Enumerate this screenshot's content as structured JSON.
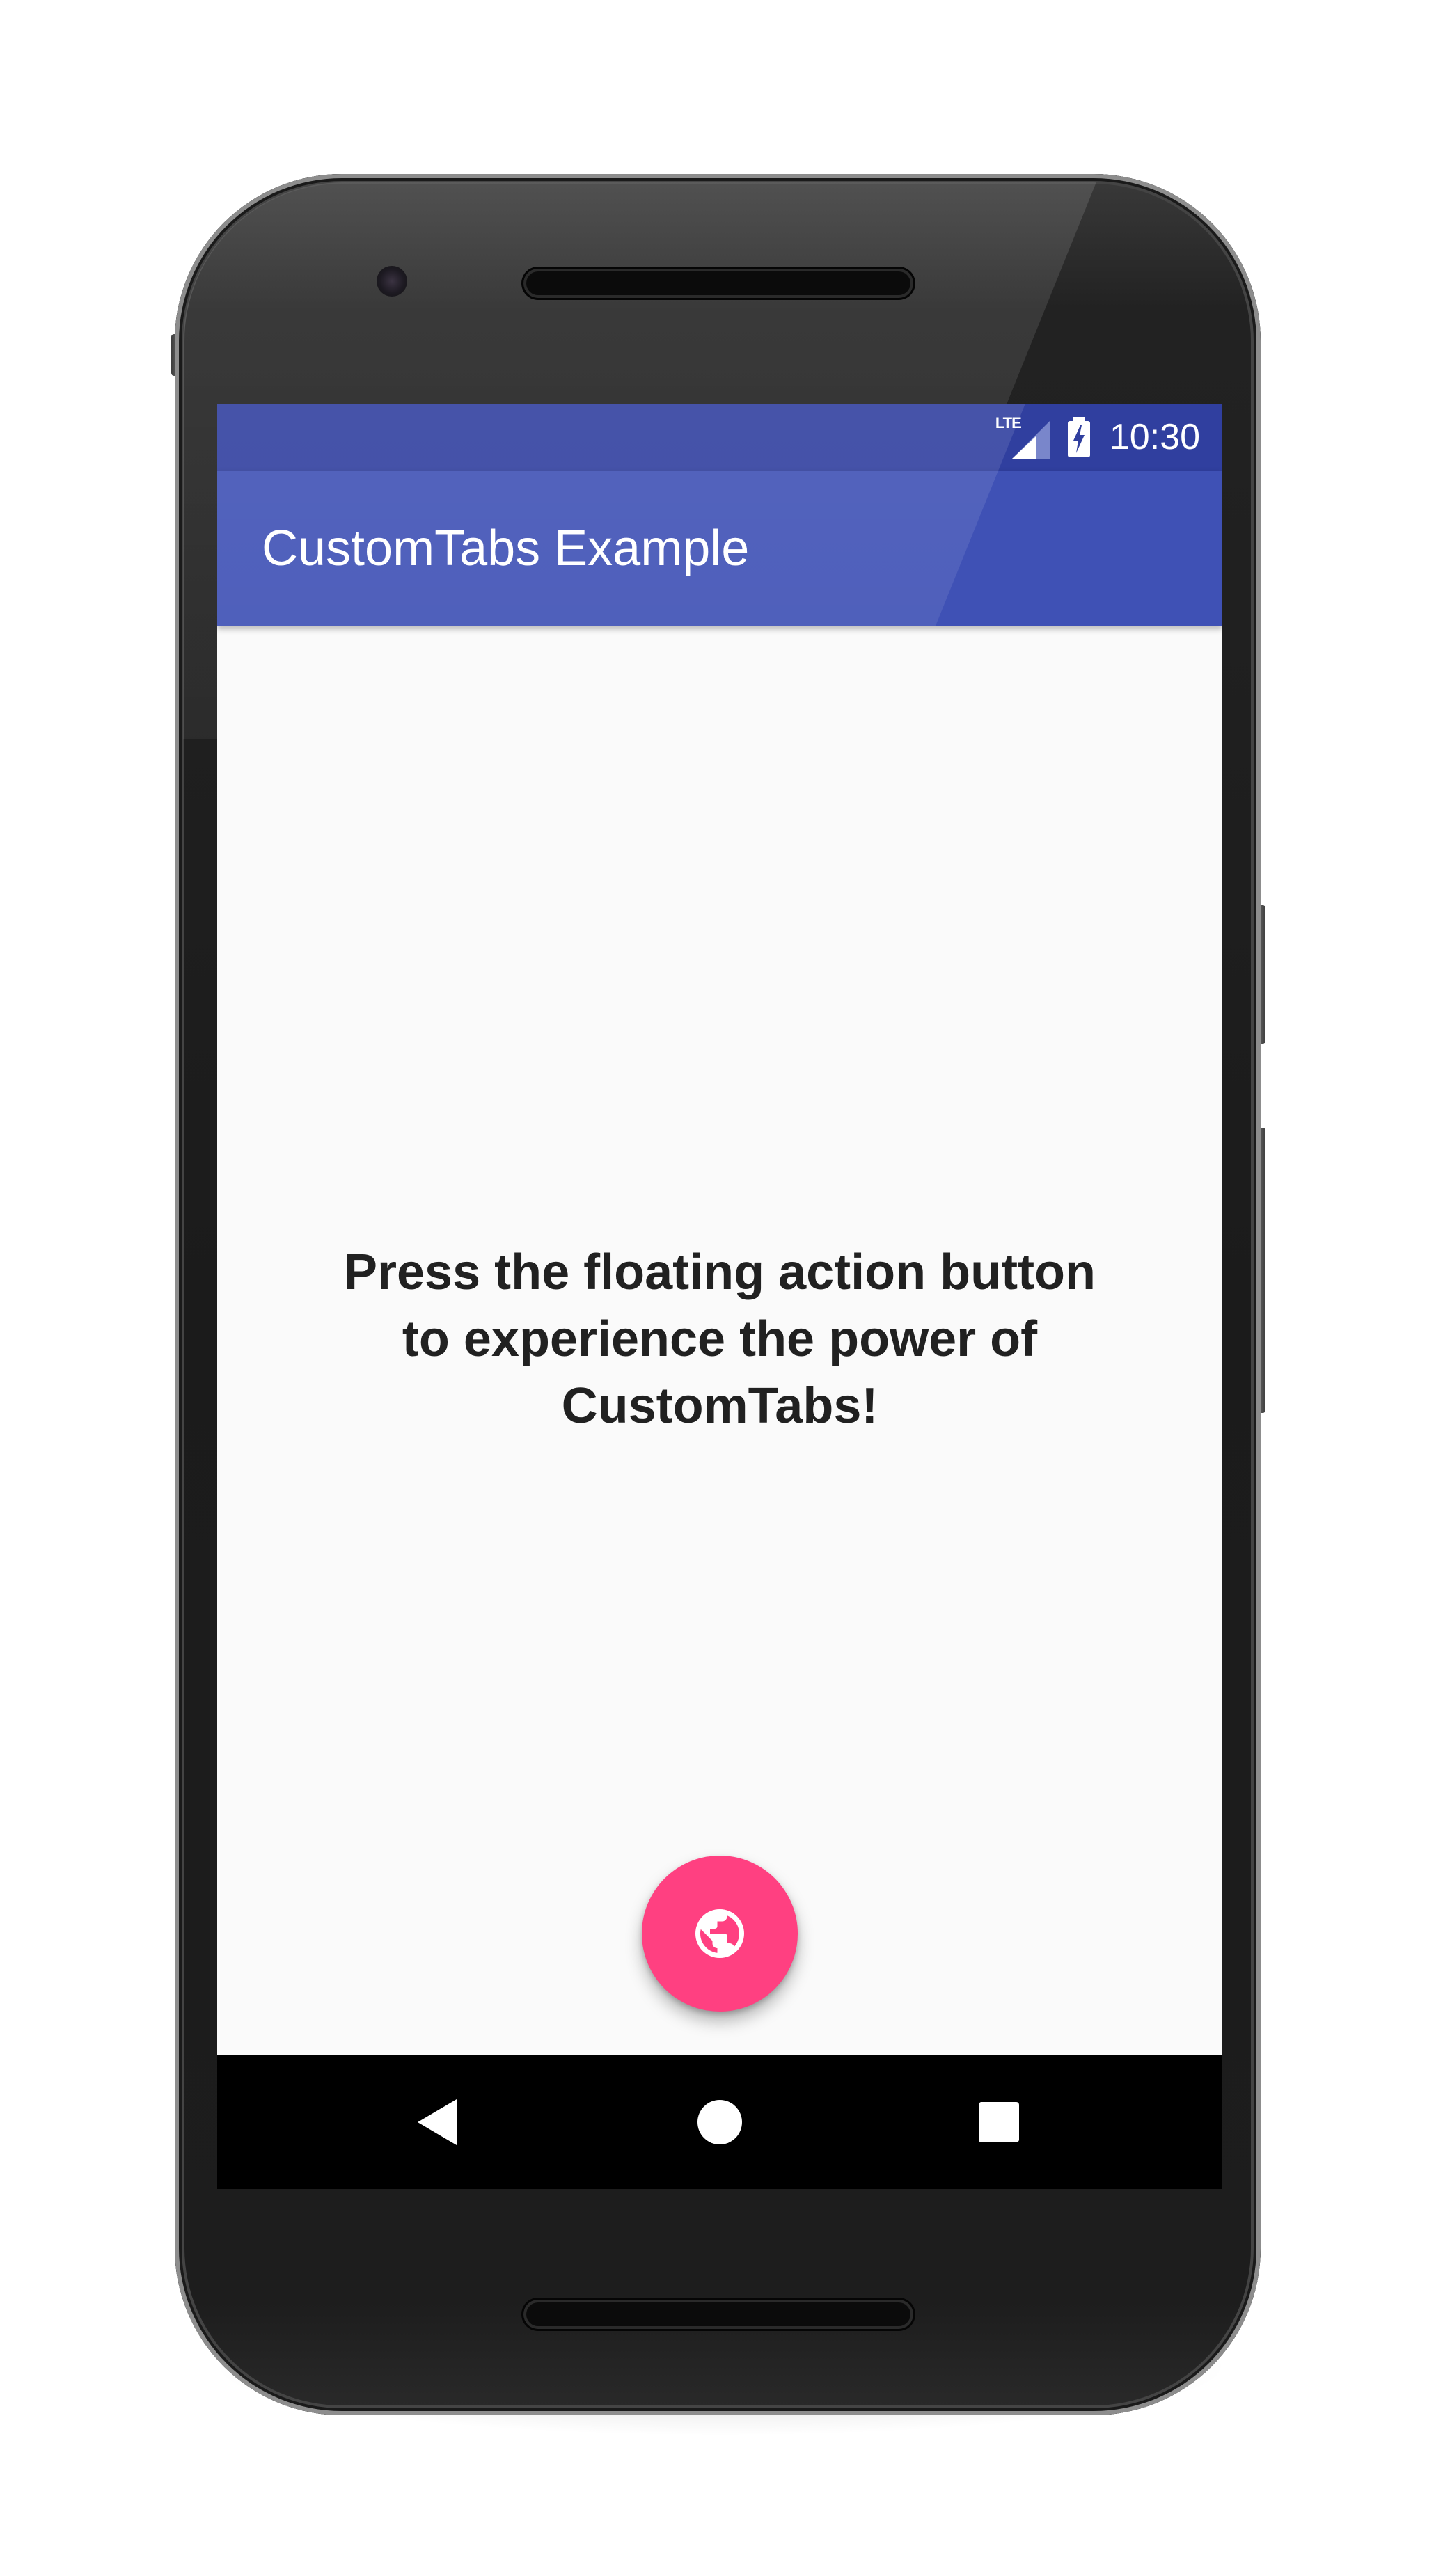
{
  "status_bar": {
    "network_label": "LTE",
    "time": "10:30",
    "icons": [
      "lte-signal-icon",
      "battery-charging-icon"
    ],
    "color": "#303f9f"
  },
  "app_bar": {
    "title": "CustomTabs Example",
    "color": "#3f51b5"
  },
  "main": {
    "message": "Press the floating action button\nto experience the power of\nCustomTabs!",
    "text_color": "#212121",
    "background": "#fafafa"
  },
  "fab": {
    "icon": "globe-icon",
    "color": "#ff4081"
  },
  "nav_bar": {
    "buttons": [
      {
        "name": "back",
        "icon": "back-triangle-icon"
      },
      {
        "name": "home",
        "icon": "home-circle-icon"
      },
      {
        "name": "recents",
        "icon": "recents-square-icon"
      }
    ]
  }
}
